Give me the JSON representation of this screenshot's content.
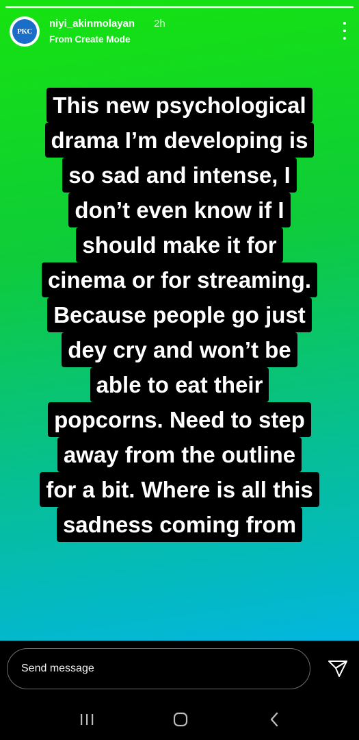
{
  "story": {
    "progress": 1.0,
    "user": {
      "avatar_text": "PKC",
      "username": "niyi_akinmolayan",
      "time_ago": "2h",
      "subtitle": "From Create Mode"
    },
    "text_lines": [
      "This new psychological",
      "drama I’m developing is",
      "so sad and intense, I",
      "don’t even know if I",
      "should make it for",
      "cinema or for streaming.",
      "Because people go just",
      "dey cry and won’t be",
      "able to eat their",
      "popcorns. Need to step",
      "away from the outline",
      "for a bit. Where is all this",
      "sadness coming from"
    ],
    "gradient_colors": [
      "#16e30f",
      "#06bf92",
      "#03b6df"
    ]
  },
  "message_bar": {
    "placeholder": "Send message",
    "send_icon": "paper-plane-icon"
  },
  "navigation": {
    "buttons": [
      "recents-icon",
      "home-icon",
      "back-icon"
    ]
  }
}
